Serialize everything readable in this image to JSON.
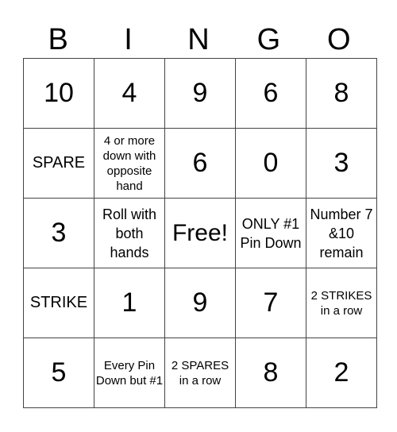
{
  "header": {
    "letters": [
      "B",
      "I",
      "N",
      "G",
      "O"
    ]
  },
  "rows": [
    [
      {
        "text": "10",
        "style": "big"
      },
      {
        "text": "4",
        "style": "big"
      },
      {
        "text": "9",
        "style": "big"
      },
      {
        "text": "6",
        "style": "big"
      },
      {
        "text": "8",
        "style": "big"
      }
    ],
    [
      {
        "text": "SPARE",
        "style": "word"
      },
      {
        "text": "4 or more down with opposite hand",
        "style": "small"
      },
      {
        "text": "6",
        "style": "big"
      },
      {
        "text": "0",
        "style": "big"
      },
      {
        "text": "3",
        "style": "big"
      }
    ],
    [
      {
        "text": "3",
        "style": "big"
      },
      {
        "text": "Roll with both hands",
        "style": "text"
      },
      {
        "text": "Free!",
        "style": "free"
      },
      {
        "text": "ONLY #1 Pin Down",
        "style": "text"
      },
      {
        "text": "Number 7 &10 remain",
        "style": "text"
      }
    ],
    [
      {
        "text": "STRIKE",
        "style": "word"
      },
      {
        "text": "1",
        "style": "big"
      },
      {
        "text": "9",
        "style": "big"
      },
      {
        "text": "7",
        "style": "big"
      },
      {
        "text": "2 STRIKES in a row",
        "style": "small"
      }
    ],
    [
      {
        "text": "5",
        "style": "big"
      },
      {
        "text": "Every Pin Down but #1",
        "style": "small"
      },
      {
        "text": "2 SPARES in a row",
        "style": "small"
      },
      {
        "text": "8",
        "style": "big"
      },
      {
        "text": "2",
        "style": "big"
      }
    ]
  ]
}
